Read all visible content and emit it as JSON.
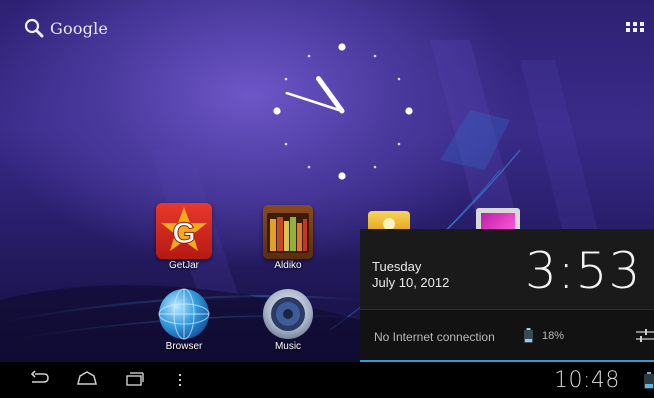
{
  "search": {
    "label": "Google",
    "icon": "search-icon"
  },
  "clock": {
    "hour": 10,
    "minute": 48
  },
  "apps": [
    {
      "name": "GetJar",
      "icon": "getjar-icon"
    },
    {
      "name": "Aldiko",
      "icon": "aldiko-icon"
    },
    {
      "name": "Browser",
      "icon": "browser-icon"
    },
    {
      "name": "Music",
      "icon": "music-icon"
    }
  ],
  "notification_panel": {
    "day": "Tuesday",
    "date": "July 10, 2012",
    "time": "3:53",
    "network_status": "No Internet connection",
    "battery_percent": "18%",
    "accent_color": "#2e9fd6"
  },
  "system_bar": {
    "time": "10:48",
    "nav_icons": [
      "back-icon",
      "home-icon",
      "recent-apps-icon",
      "menu-icon"
    ]
  },
  "colors": {
    "wallpaper": "#3a2b8a",
    "panel": "#121212"
  }
}
